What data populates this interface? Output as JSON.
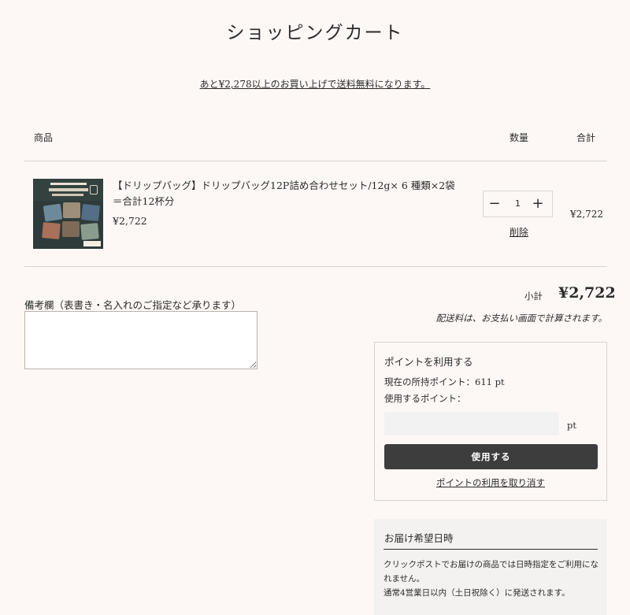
{
  "page": {
    "title": "ショッピングカート",
    "shipping_notice": "あと¥2,278以上のお買い上げで送料無料になります。"
  },
  "table": {
    "headers": {
      "product": "商品",
      "quantity": "数量",
      "total": "合計"
    }
  },
  "items": [
    {
      "name": "【ドリップバッグ】ドリップバッグ12P詰め合わせセット/12g× 6 種類×2袋＝合計12杯分",
      "price": "¥2,722",
      "quantity": "1",
      "remove_label": "削除",
      "line_total": "¥2,722",
      "image_alt": "ドリップバッグ12P詰め合わせセット"
    }
  ],
  "notes": {
    "label": "備考欄（表書き・名入れのご指定など承ります）",
    "value": ""
  },
  "summary": {
    "subtotal_label": "小計",
    "subtotal_value": "¥2,722",
    "shipping_note": "配送料は、お支払い画面で計算されます。"
  },
  "points": {
    "title": "ポイントを利用する",
    "current_points": "現在の所持ポイント：611 pt",
    "use_label": "使用するポイント：",
    "input_value": "",
    "unit": "pt",
    "apply_label": "使用する",
    "cancel_label": "ポイントの利用を取り消す"
  },
  "delivery": {
    "title": "お届け希望日時",
    "text_line1": "クリックポストでお届けの商品では日時指定をご利用になれません。",
    "text_line2": "通常4営業日以内（土日祝除く）に発送されます。"
  }
}
